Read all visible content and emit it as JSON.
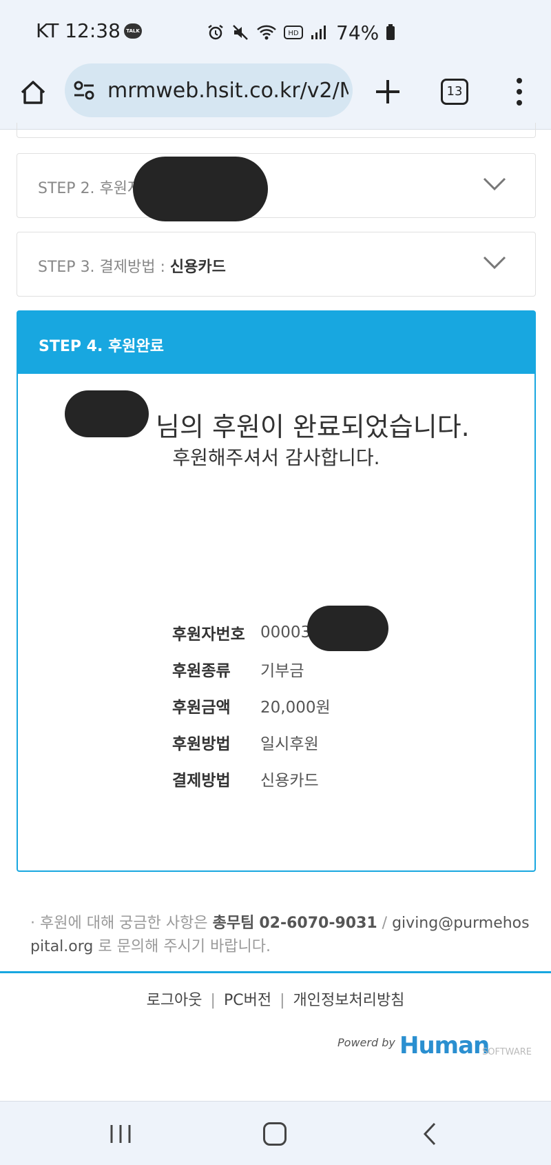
{
  "status_bar": {
    "carrier_time": "KT 12:38",
    "talk_badge": "TALK",
    "icons": [
      "alarm-icon",
      "mute-icon",
      "wifi-icon",
      "hd-icon",
      "signal-icon",
      "battery-icon"
    ],
    "hd_label": "HD",
    "battery": "74%"
  },
  "browser": {
    "url": "mrmweb.hsit.co.kr/v2/M",
    "tab_count": "13"
  },
  "steps": {
    "step2_label": "STEP 2. 후원자",
    "step3_label": "STEP 3. 결제방법 : ",
    "step3_value": "신용카드",
    "step4_title": "STEP 4. 후원완료"
  },
  "completion": {
    "message": "님의 후원이 완료되었습니다.",
    "thanks": "후원해주셔서 감사합니다."
  },
  "info": [
    {
      "key": "후원자번호",
      "value": "00003"
    },
    {
      "key": "후원종류",
      "value": "기부금"
    },
    {
      "key": "후원금액",
      "value": "20,000원"
    },
    {
      "key": "후원방법",
      "value": "일시후원"
    },
    {
      "key": "결제방법",
      "value": "신용카드"
    }
  ],
  "contact": {
    "prefix": "· 후원에 대해 궁금한 사항은 ",
    "team": "총무팀",
    "phone": "02-6070-9031",
    "slash": " / ",
    "email": "giving@purmehospital.org",
    "suffix": " 로 문의해 주시기 바랍니다."
  },
  "footer": {
    "logout": "로그아웃",
    "pc_version": "PC버전",
    "privacy": "개인정보처리방침",
    "separator": "|",
    "powered_by": "Powerd by",
    "brand": "Human",
    "brand_suffix": "SOFTWARE"
  },
  "colors": {
    "accent": "#18a7e0",
    "system_bar": "#eef3fa",
    "url_box": "#d6e6f2"
  }
}
